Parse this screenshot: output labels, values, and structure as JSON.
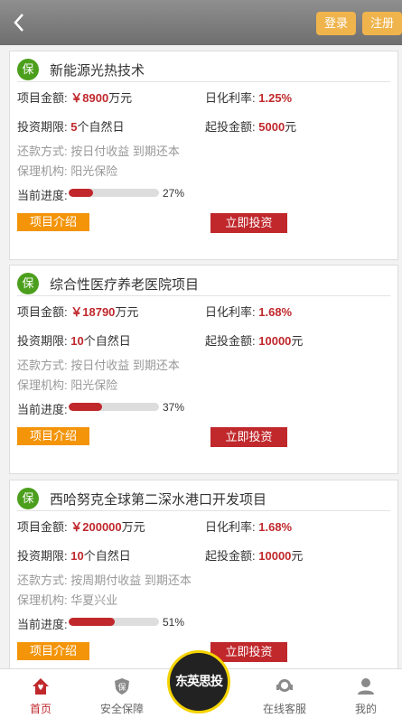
{
  "header": {
    "back_icon": "chevron-left-icon",
    "login": "登录",
    "register": "注册"
  },
  "labels": {
    "amount": "项目金额:",
    "rate": "日化利率:",
    "term": "投资期限:",
    "min_invest": "起投金额:",
    "progress": "当前进度:",
    "intro_button": "项目介绍",
    "invest_button": "立即投资",
    "badge": "保"
  },
  "projects": [
    {
      "title": "新能源光热技术",
      "amount": "￥8900",
      "amount_unit": "万元",
      "rate": "1.25%",
      "term_value": "5",
      "term_unit": "个自然日",
      "min_value": "5000",
      "min_unit": "元",
      "repayment": "还款方式: 按日付收益 到期还本",
      "guarantor": "保理机构: 阳光保险",
      "progress": 27,
      "progress_text": "27%"
    },
    {
      "title": "综合性医疗养老医院项目",
      "amount": "￥18790",
      "amount_unit": "万元",
      "rate": "1.68%",
      "term_value": "10",
      "term_unit": "个自然日",
      "min_value": "10000",
      "min_unit": "元",
      "repayment": "还款方式: 按日付收益 到期还本",
      "guarantor": "保理机构: 阳光保险",
      "progress": 37,
      "progress_text": "37%"
    },
    {
      "title": "西哈努克全球第二深水港口开发项目",
      "amount": "￥200000",
      "amount_unit": "万元",
      "rate": "1.68%",
      "term_value": "10",
      "term_unit": "个自然日",
      "min_value": "10000",
      "min_unit": "元",
      "repayment": "还款方式: 按周期付收益 到期还本",
      "guarantor": "保理机构: 华夏兴业",
      "progress": 51,
      "progress_text": "51%"
    }
  ],
  "tabbar": {
    "home": "首页",
    "security": "安全保障",
    "logo_text": "东英思投",
    "service": "在线客服",
    "mine": "我的"
  },
  "colors": {
    "accent": "#c0282c",
    "orange": "#f39409",
    "header_button": "#f0b44d",
    "badge_green": "#4c9f1c"
  }
}
